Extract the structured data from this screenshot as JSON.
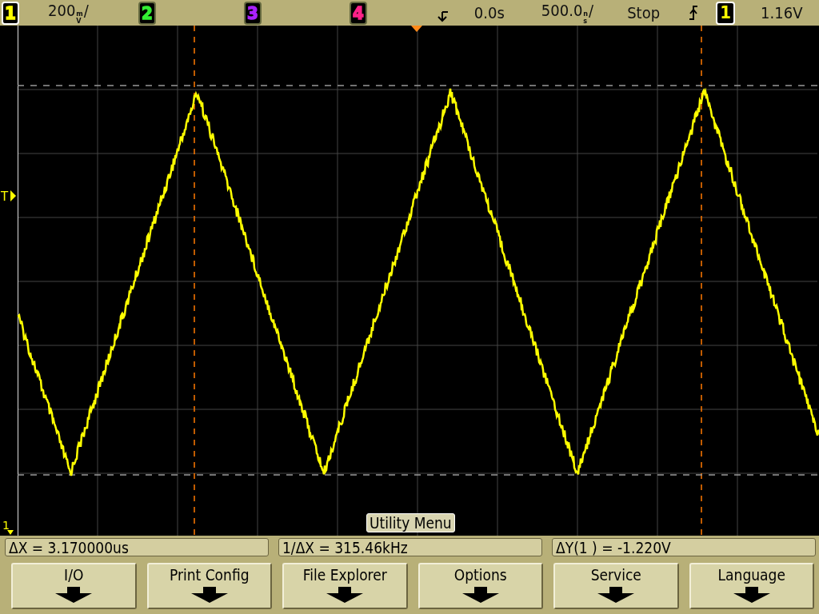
{
  "status_bar": {
    "channels": [
      {
        "label": "1",
        "color": "#ffff00",
        "selected": true
      },
      {
        "label": "2",
        "color": "#33ee33",
        "selected": false
      },
      {
        "label": "3",
        "color": "#aa22ff",
        "selected": false
      },
      {
        "label": "4",
        "color": "#ff2288",
        "selected": false
      }
    ],
    "scale": {
      "value": "200",
      "unit_top": "m",
      "unit_bottom": "V",
      "suffix": "/"
    },
    "delay": "0.0s",
    "timebase": {
      "value": "500.0",
      "unit_top": "n",
      "unit_bottom": "s",
      "suffix": "/"
    },
    "run_state": "Stop",
    "trigger_source": {
      "label": "1",
      "color": "#ffff00"
    },
    "trigger_level": "1.16V"
  },
  "screen": {
    "trigger_marker": "T",
    "ground_marker": "1",
    "menu_title": "Utility Menu"
  },
  "measurements": [
    "ΔX = 3.170000us",
    "1/ΔX = 315.46kHz",
    "ΔY(1 ) = -1.220V"
  ],
  "softkeys": [
    "I/O",
    "Print Config",
    "File Explorer",
    "Options",
    "Service",
    "Language"
  ]
}
